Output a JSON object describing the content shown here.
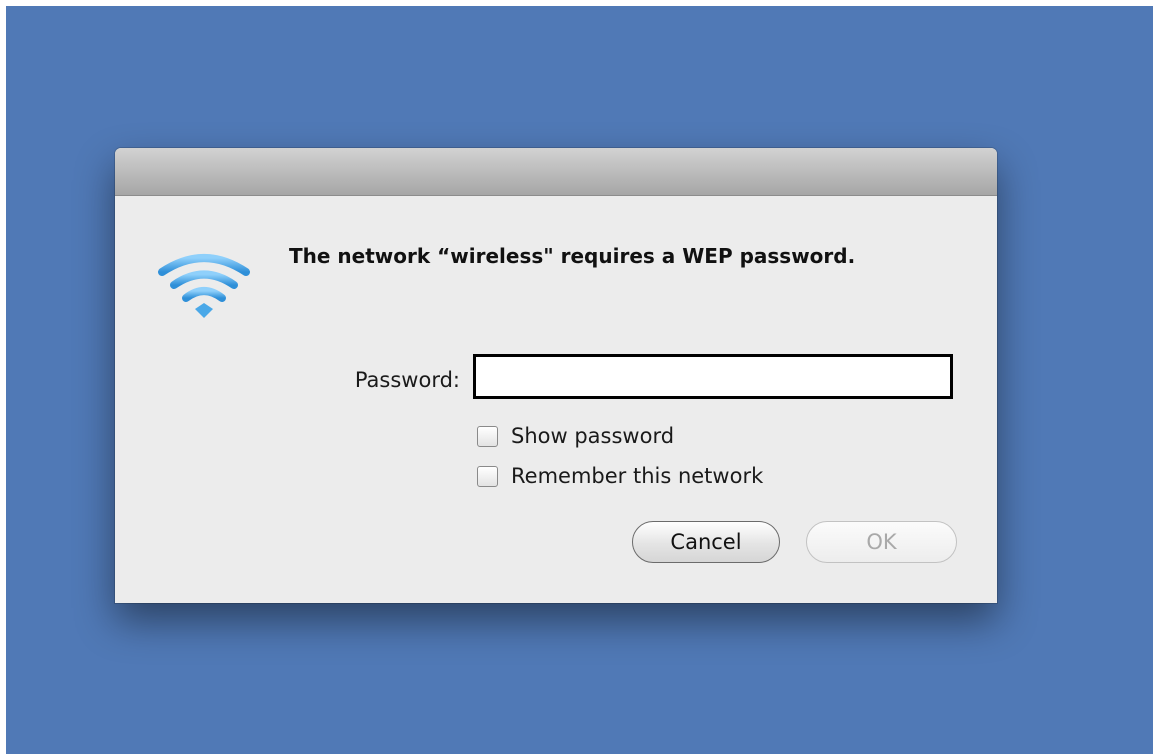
{
  "dialog": {
    "message": "The network “wireless\" requires a WEP password.",
    "icon": "wifi-icon"
  },
  "password": {
    "label": "Password:",
    "value": "",
    "placeholder": ""
  },
  "options": {
    "show_password": {
      "label": "Show password",
      "checked": false
    },
    "remember_network": {
      "label": "Remember this network",
      "checked": false
    }
  },
  "buttons": {
    "cancel_label": "Cancel",
    "ok_label": "OK"
  },
  "colors": {
    "desktop": "#5079b6",
    "dialog_bg": "#ececec",
    "wifi_blue": "#4aa8e8"
  }
}
